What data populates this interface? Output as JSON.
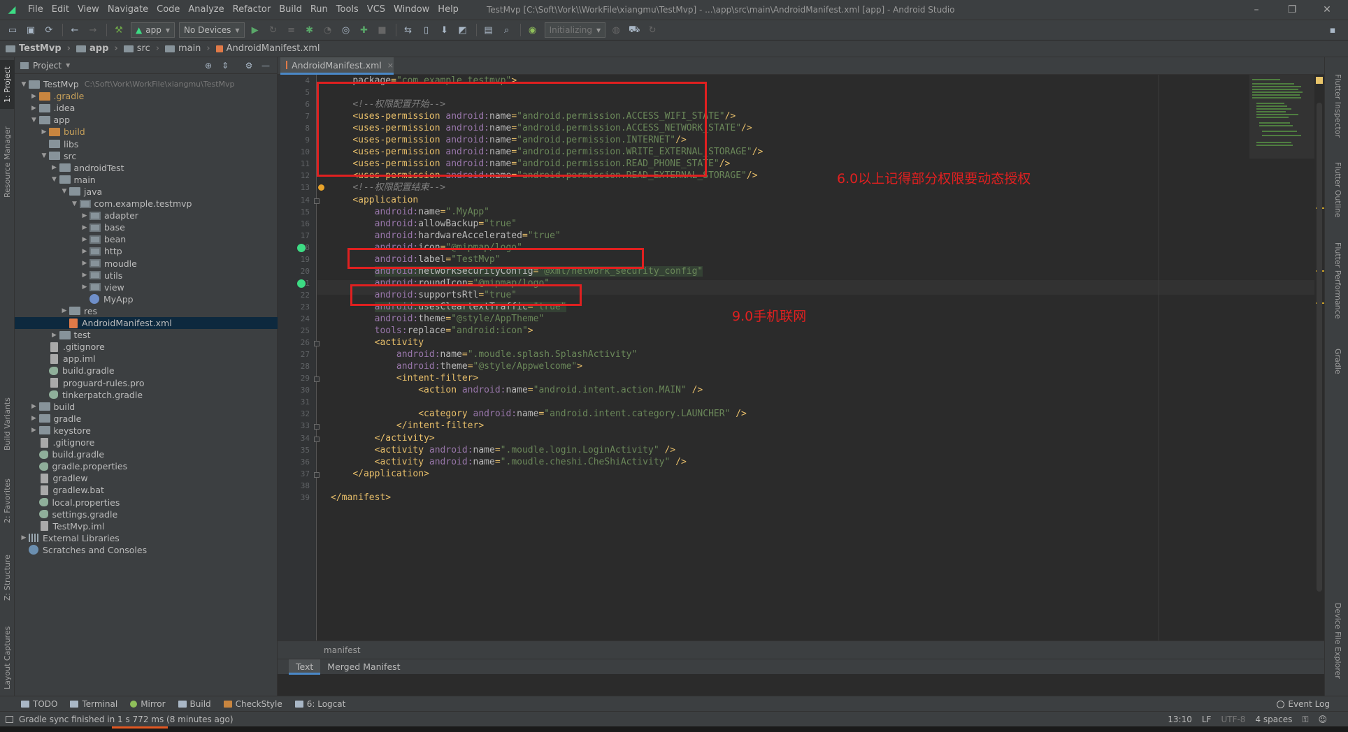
{
  "window": {
    "title": "TestMvp [C:\\Soft\\Vork\\\\WorkFile\\xiangmu\\TestMvp] - ...\\app\\src\\main\\AndroidManifest.xml [app] - Android Studio",
    "menus": [
      "File",
      "Edit",
      "View",
      "Navigate",
      "Code",
      "Analyze",
      "Refactor",
      "Build",
      "Run",
      "Tools",
      "VCS",
      "Window",
      "Help"
    ],
    "controls": [
      "–",
      "❐",
      "✕"
    ]
  },
  "toolbar": {
    "run_config": "app",
    "device": "No Devices",
    "status_combo": "Initializing"
  },
  "breadcrumb": [
    "TestMvp",
    "app",
    "src",
    "main",
    "AndroidManifest.xml"
  ],
  "left_strip": {
    "tabs": [
      "1: Project",
      "Resource Manager",
      "Build Variants",
      "2: Favorites",
      "Z: Structure",
      "Layout Captures"
    ]
  },
  "right_strip": {
    "tabs": [
      "Flutter Inspector",
      "Flutter Outline",
      "Flutter Performance",
      "Gradle",
      "Device File Explorer"
    ]
  },
  "project_panel": {
    "header": "Project",
    "tree": [
      {
        "label": "TestMvp",
        "hint": "C:\\Soft\\Vork\\WorkFile\\xiangmu\\TestMvp",
        "indent": 0,
        "arrow": "▼",
        "icon": "folder"
      },
      {
        "label": ".gradle",
        "indent": 1,
        "arrow": "▶",
        "icon": "orange"
      },
      {
        "label": ".idea",
        "indent": 1,
        "arrow": "▶",
        "icon": "folder"
      },
      {
        "label": "app",
        "indent": 1,
        "arrow": "▼",
        "icon": "folder"
      },
      {
        "label": "build",
        "indent": 2,
        "arrow": "▶",
        "icon": "orange"
      },
      {
        "label": "libs",
        "indent": 2,
        "arrow": "",
        "icon": "folder"
      },
      {
        "label": "src",
        "indent": 2,
        "arrow": "▼",
        "icon": "folder"
      },
      {
        "label": "androidTest",
        "indent": 3,
        "arrow": "▶",
        "icon": "folder"
      },
      {
        "label": "main",
        "indent": 3,
        "arrow": "▼",
        "icon": "folder"
      },
      {
        "label": "java",
        "indent": 4,
        "arrow": "▼",
        "icon": "folder"
      },
      {
        "label": "com.example.testmvp",
        "indent": 5,
        "arrow": "▼",
        "icon": "pkg"
      },
      {
        "label": "adapter",
        "indent": 6,
        "arrow": "▶",
        "icon": "pkg"
      },
      {
        "label": "base",
        "indent": 6,
        "arrow": "▶",
        "icon": "pkg"
      },
      {
        "label": "bean",
        "indent": 6,
        "arrow": "▶",
        "icon": "pkg"
      },
      {
        "label": "http",
        "indent": 6,
        "arrow": "▶",
        "icon": "pkg"
      },
      {
        "label": "moudle",
        "indent": 6,
        "arrow": "▶",
        "icon": "pkg"
      },
      {
        "label": "utils",
        "indent": 6,
        "arrow": "▶",
        "icon": "pkg"
      },
      {
        "label": "view",
        "indent": 6,
        "arrow": "▶",
        "icon": "pkg"
      },
      {
        "label": "MyApp",
        "indent": 6,
        "arrow": "",
        "icon": "kt"
      },
      {
        "label": "res",
        "indent": 4,
        "arrow": "▶",
        "icon": "folder"
      },
      {
        "label": "AndroidManifest.xml",
        "indent": 4,
        "arrow": "",
        "icon": "xml",
        "selected": true
      },
      {
        "label": "test",
        "indent": 3,
        "arrow": "▶",
        "icon": "folder"
      },
      {
        "label": ".gitignore",
        "indent": 2,
        "arrow": "",
        "icon": "file"
      },
      {
        "label": "app.iml",
        "indent": 2,
        "arrow": "",
        "icon": "file"
      },
      {
        "label": "build.gradle",
        "indent": 2,
        "arrow": "",
        "icon": "gradle"
      },
      {
        "label": "proguard-rules.pro",
        "indent": 2,
        "arrow": "",
        "icon": "file"
      },
      {
        "label": "tinkerpatch.gradle",
        "indent": 2,
        "arrow": "",
        "icon": "gradle"
      },
      {
        "label": "build",
        "indent": 1,
        "arrow": "▶",
        "icon": "folder"
      },
      {
        "label": "gradle",
        "indent": 1,
        "arrow": "▶",
        "icon": "folder"
      },
      {
        "label": "keystore",
        "indent": 1,
        "arrow": "▶",
        "icon": "folder"
      },
      {
        "label": ".gitignore",
        "indent": 1,
        "arrow": "",
        "icon": "file"
      },
      {
        "label": "build.gradle",
        "indent": 1,
        "arrow": "",
        "icon": "gradle"
      },
      {
        "label": "gradle.properties",
        "indent": 1,
        "arrow": "",
        "icon": "gradle"
      },
      {
        "label": "gradlew",
        "indent": 1,
        "arrow": "",
        "icon": "file"
      },
      {
        "label": "gradlew.bat",
        "indent": 1,
        "arrow": "",
        "icon": "file"
      },
      {
        "label": "local.properties",
        "indent": 1,
        "arrow": "",
        "icon": "gradle"
      },
      {
        "label": "settings.gradle",
        "indent": 1,
        "arrow": "",
        "icon": "gradle"
      },
      {
        "label": "TestMvp.iml",
        "indent": 1,
        "arrow": "",
        "icon": "file"
      },
      {
        "label": "External Libraries",
        "indent": 0,
        "arrow": "▶",
        "icon": "lib"
      },
      {
        "label": "Scratches and Consoles",
        "indent": 0,
        "arrow": "",
        "icon": "scratch"
      }
    ]
  },
  "editor": {
    "tab": "AndroidManifest.xml",
    "footer": "manifest",
    "lines": [
      {
        "n": 4,
        "tokens": [
          [
            "i",
            "    "
          ],
          [
            "attr",
            "package"
          ],
          [
            "punc",
            "="
          ],
          [
            "val",
            "\"com.example.testmvp\""
          ],
          [
            "tag",
            ">"
          ]
        ]
      },
      {
        "n": 5,
        "tokens": []
      },
      {
        "n": 6,
        "tokens": [
          [
            "i",
            "    "
          ],
          [
            "cmt",
            "<!--权限配置开始-->"
          ]
        ]
      },
      {
        "n": 7,
        "tokens": [
          [
            "i",
            "    "
          ],
          [
            "tag",
            "<uses-permission "
          ],
          [
            "ns",
            "android:"
          ],
          [
            "attr",
            "name"
          ],
          [
            "punc",
            "="
          ],
          [
            "val",
            "\"android.permission.ACCESS_WIFI_STATE\""
          ],
          [
            "tag",
            "/>"
          ]
        ]
      },
      {
        "n": 8,
        "tokens": [
          [
            "i",
            "    "
          ],
          [
            "tag",
            "<uses-permission "
          ],
          [
            "ns",
            "android:"
          ],
          [
            "attr",
            "name"
          ],
          [
            "punc",
            "="
          ],
          [
            "val",
            "\"android.permission.ACCESS_NETWORK_STATE\""
          ],
          [
            "tag",
            "/>"
          ]
        ]
      },
      {
        "n": 9,
        "tokens": [
          [
            "i",
            "    "
          ],
          [
            "tag",
            "<uses-permission "
          ],
          [
            "ns",
            "android:"
          ],
          [
            "attr",
            "name"
          ],
          [
            "punc",
            "="
          ],
          [
            "val",
            "\"android.permission.INTERNET\""
          ],
          [
            "tag",
            "/>"
          ]
        ]
      },
      {
        "n": 10,
        "tokens": [
          [
            "i",
            "    "
          ],
          [
            "tag",
            "<uses-permission "
          ],
          [
            "ns",
            "android:"
          ],
          [
            "attr",
            "name"
          ],
          [
            "punc",
            "="
          ],
          [
            "val",
            "\"android.permission.WRITE_EXTERNAL_STORAGE\""
          ],
          [
            "tag",
            "/>"
          ]
        ]
      },
      {
        "n": 11,
        "tokens": [
          [
            "i",
            "    "
          ],
          [
            "tag",
            "<uses-permission "
          ],
          [
            "ns",
            "android:"
          ],
          [
            "attr",
            "name"
          ],
          [
            "punc",
            "="
          ],
          [
            "val",
            "\"android.permission.READ_PHONE_STATE\""
          ],
          [
            "tag",
            "/>"
          ]
        ]
      },
      {
        "n": 12,
        "tokens": [
          [
            "i",
            "    "
          ],
          [
            "tag",
            "<uses-permission "
          ],
          [
            "ns",
            "android:"
          ],
          [
            "attr",
            "name"
          ],
          [
            "punc",
            "="
          ],
          [
            "val",
            "\"android.permission.READ_EXTERNAL_STORAGE\""
          ],
          [
            "tag",
            "/>"
          ]
        ]
      },
      {
        "n": 13,
        "tokens": [
          [
            "i",
            "    "
          ],
          [
            "cmt",
            "<!--权限配置结束-->"
          ]
        ]
      },
      {
        "n": 14,
        "tokens": [
          [
            "i",
            "    "
          ],
          [
            "tag",
            "<application"
          ]
        ]
      },
      {
        "n": 15,
        "tokens": [
          [
            "i",
            "        "
          ],
          [
            "ns",
            "android:"
          ],
          [
            "attr",
            "name"
          ],
          [
            "punc",
            "="
          ],
          [
            "val",
            "\".MyApp\""
          ]
        ]
      },
      {
        "n": 16,
        "tokens": [
          [
            "i",
            "        "
          ],
          [
            "ns",
            "android:"
          ],
          [
            "attr",
            "allowBackup"
          ],
          [
            "punc",
            "="
          ],
          [
            "val",
            "\"true\""
          ]
        ]
      },
      {
        "n": 17,
        "tokens": [
          [
            "i",
            "        "
          ],
          [
            "ns",
            "android:"
          ],
          [
            "attr",
            "hardwareAccelerated"
          ],
          [
            "punc",
            "="
          ],
          [
            "val",
            "\"true\""
          ]
        ]
      },
      {
        "n": 18,
        "tokens": [
          [
            "i",
            "        "
          ],
          [
            "ns",
            "android:"
          ],
          [
            "attr",
            "icon"
          ],
          [
            "punc",
            "="
          ],
          [
            "val",
            "\"@mipmap/logo\""
          ]
        ]
      },
      {
        "n": 19,
        "tokens": [
          [
            "i",
            "        "
          ],
          [
            "ns",
            "android:"
          ],
          [
            "attr",
            "label"
          ],
          [
            "punc",
            "="
          ],
          [
            "val",
            "\"TestMvp\""
          ]
        ]
      },
      {
        "n": 20,
        "tokens": [
          [
            "i",
            "        "
          ],
          [
            "ns",
            "android:"
          ],
          [
            "attr",
            "networkSecurityConfig"
          ],
          [
            "punc",
            "="
          ],
          [
            "val",
            "\"@xml/network_security_config\""
          ]
        ],
        "hl": true
      },
      {
        "n": 21,
        "tokens": [
          [
            "i",
            "        "
          ],
          [
            "ns",
            "android:"
          ],
          [
            "attr",
            "roundIcon"
          ],
          [
            "punc",
            "="
          ],
          [
            "val",
            "\"@mipmap/logo\""
          ]
        ]
      },
      {
        "n": 22,
        "tokens": [
          [
            "i",
            "        "
          ],
          [
            "ns",
            "android:"
          ],
          [
            "attr",
            "supportsRtl"
          ],
          [
            "punc",
            "="
          ],
          [
            "val",
            "\"true\""
          ]
        ]
      },
      {
        "n": 23,
        "tokens": [
          [
            "i",
            "        "
          ],
          [
            "ns",
            "android:"
          ],
          [
            "attr",
            "usesCleartextTraffic"
          ],
          [
            "punc",
            "="
          ],
          [
            "val",
            "\"true\""
          ]
        ],
        "hl": true
      },
      {
        "n": 24,
        "tokens": [
          [
            "i",
            "        "
          ],
          [
            "ns",
            "android:"
          ],
          [
            "attr",
            "theme"
          ],
          [
            "punc",
            "="
          ],
          [
            "val",
            "\"@style/AppTheme\""
          ]
        ]
      },
      {
        "n": 25,
        "tokens": [
          [
            "i",
            "        "
          ],
          [
            "ns",
            "tools:"
          ],
          [
            "attr",
            "replace"
          ],
          [
            "punc",
            "="
          ],
          [
            "val",
            "\"android:icon\""
          ],
          [
            "tag",
            ">"
          ]
        ]
      },
      {
        "n": 26,
        "tokens": [
          [
            "i",
            "        "
          ],
          [
            "tag",
            "<activity"
          ]
        ]
      },
      {
        "n": 27,
        "tokens": [
          [
            "i",
            "            "
          ],
          [
            "ns",
            "android:"
          ],
          [
            "attr",
            "name"
          ],
          [
            "punc",
            "="
          ],
          [
            "val",
            "\".moudle.splash.SplashActivity\""
          ]
        ]
      },
      {
        "n": 28,
        "tokens": [
          [
            "i",
            "            "
          ],
          [
            "ns",
            "android:"
          ],
          [
            "attr",
            "theme"
          ],
          [
            "punc",
            "="
          ],
          [
            "val",
            "\"@style/Appwelcome\""
          ],
          [
            "tag",
            ">"
          ]
        ]
      },
      {
        "n": 29,
        "tokens": [
          [
            "i",
            "            "
          ],
          [
            "tag",
            "<intent-filter>"
          ]
        ]
      },
      {
        "n": 30,
        "tokens": [
          [
            "i",
            "                "
          ],
          [
            "tag",
            "<action "
          ],
          [
            "ns",
            "android:"
          ],
          [
            "attr",
            "name"
          ],
          [
            "punc",
            "="
          ],
          [
            "val",
            "\"android.intent.action.MAIN\""
          ],
          [
            "tag",
            " />"
          ]
        ]
      },
      {
        "n": 31,
        "tokens": []
      },
      {
        "n": 32,
        "tokens": [
          [
            "i",
            "                "
          ],
          [
            "tag",
            "<category "
          ],
          [
            "ns",
            "android:"
          ],
          [
            "attr",
            "name"
          ],
          [
            "punc",
            "="
          ],
          [
            "val",
            "\"android.intent.category.LAUNCHER\""
          ],
          [
            "tag",
            " />"
          ]
        ]
      },
      {
        "n": 33,
        "tokens": [
          [
            "i",
            "            "
          ],
          [
            "tag",
            "</intent-filter>"
          ]
        ]
      },
      {
        "n": 34,
        "tokens": [
          [
            "i",
            "        "
          ],
          [
            "tag",
            "</activity>"
          ]
        ]
      },
      {
        "n": 35,
        "tokens": [
          [
            "i",
            "        "
          ],
          [
            "tag",
            "<activity "
          ],
          [
            "ns",
            "android:"
          ],
          [
            "attr",
            "name"
          ],
          [
            "punc",
            "="
          ],
          [
            "val",
            "\".moudle.login.LoginActivity\""
          ],
          [
            "tag",
            " />"
          ]
        ]
      },
      {
        "n": 36,
        "tokens": [
          [
            "i",
            "        "
          ],
          [
            "tag",
            "<activity "
          ],
          [
            "ns",
            "android:"
          ],
          [
            "attr",
            "name"
          ],
          [
            "punc",
            "="
          ],
          [
            "val",
            "\".moudle.cheshi.CheShiActivity\""
          ],
          [
            "tag",
            " />"
          ]
        ]
      },
      {
        "n": 37,
        "tokens": [
          [
            "i",
            "    "
          ],
          [
            "tag",
            "</application>"
          ]
        ]
      },
      {
        "n": 38,
        "tokens": []
      },
      {
        "n": 39,
        "tokens": [
          [
            "tag",
            "</manifest>"
          ]
        ]
      }
    ],
    "annotations": {
      "permissions_note": "6.0以上记得部分权限要动态授权",
      "network_note": "9.0手机联网"
    }
  },
  "manifest_tabs": [
    "Text",
    "Merged Manifest"
  ],
  "tool_windows": [
    "TODO",
    "Terminal",
    "Mirror",
    "Build",
    "CheckStyle",
    "6: Logcat"
  ],
  "event_log": "Event Log",
  "status": {
    "message": "Gradle sync finished in 1 s 772 ms (8 minutes ago)",
    "position": "13:10",
    "line_sep": "LF",
    "encoding": "UTF-8",
    "indent": "4 spaces"
  },
  "colors": {
    "accent": "#4a88c7",
    "annotation_red": "#e02020",
    "android_green": "#3ddc84"
  }
}
